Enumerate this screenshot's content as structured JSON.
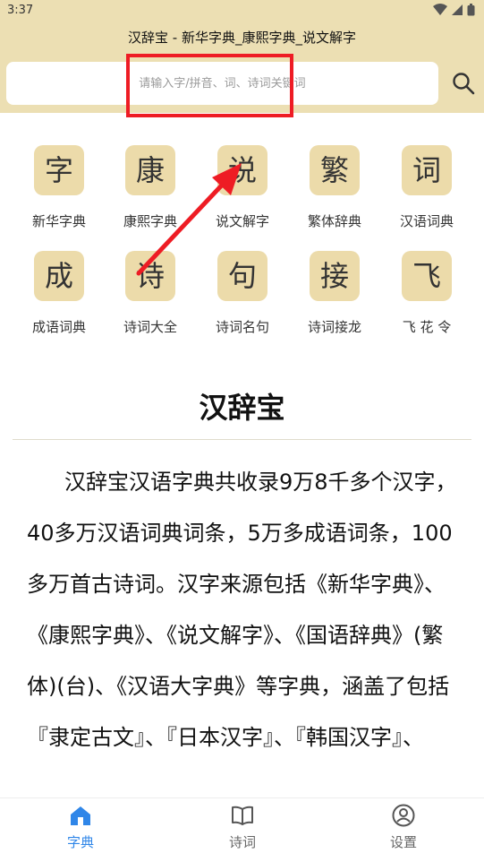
{
  "status_bar": {
    "time": "3:37"
  },
  "app": {
    "title": "汉辞宝 - 新华字典_康熙字典_说文解字"
  },
  "search": {
    "placeholder": "请输入字/拼音、词、诗词关键词"
  },
  "dictionaries": [
    {
      "char": "字",
      "label": "新华字典"
    },
    {
      "char": "康",
      "label": "康熙字典"
    },
    {
      "char": "说",
      "label": "说文解字"
    },
    {
      "char": "繁",
      "label": "繁体辞典"
    },
    {
      "char": "词",
      "label": "汉语词典"
    },
    {
      "char": "成",
      "label": "成语词典"
    },
    {
      "char": "诗",
      "label": "诗词大全"
    },
    {
      "char": "句",
      "label": "诗词名句"
    },
    {
      "char": "接",
      "label": "诗词接龙"
    },
    {
      "char": "飞",
      "label": "飞 花 令"
    }
  ],
  "about": {
    "title": "汉辞宝",
    "body": "汉辞宝汉语字典共收录9万8千多个汉字，40多万汉语词典词条，5万多成语词条，100多万首古诗词。汉字来源包括《新华字典》、《康熙字典》、《说文解字》、《国语辞典》(繁体)(台)、《汉语大字典》等字典，涵盖了包括『隶定古文』、『日本汉字』、『韩国汉字』、"
  },
  "bottom_nav": [
    {
      "label": "字典",
      "icon": "home-icon",
      "active": true
    },
    {
      "label": "诗词",
      "icon": "book-icon",
      "active": false
    },
    {
      "label": "设置",
      "icon": "user-icon",
      "active": false
    }
  ],
  "colors": {
    "header_bg": "#ecdfb3",
    "tile_bg": "#ecdbaa",
    "active_nav": "#2f86e8",
    "annotation_red": "#ee1c24"
  }
}
